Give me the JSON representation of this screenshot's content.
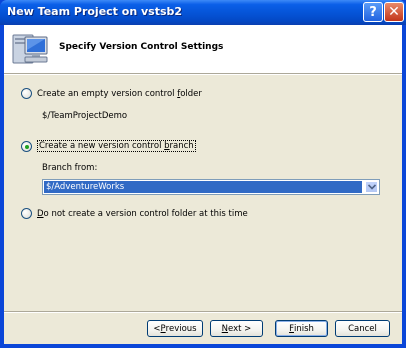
{
  "window": {
    "title": "New Team Project on vstsb2",
    "help_glyph": "?",
    "close_glyph": "✕"
  },
  "header": {
    "title": "Specify Version Control Settings",
    "icon": "computer-icon"
  },
  "options": {
    "empty_folder": {
      "label_pre": "Create an empty version control ",
      "label_accel": "f",
      "label_post": "older",
      "checked": false
    },
    "path_text": "$/TeamProjectDemo",
    "new_branch": {
      "label_pre": "Create a new version control ",
      "label_accel": "b",
      "label_post": "ranch",
      "checked": true
    },
    "branch_from_label": "Branch from:",
    "branch_from_value": "$/AdventureWorks",
    "no_folder": {
      "label_accel": "D",
      "label_post": "o not create a version control folder at this time",
      "checked": false
    }
  },
  "buttons": {
    "previous_pre": "< ",
    "previous_accel": "P",
    "previous_post": "revious",
    "next_accel": "N",
    "next_post": "ext >",
    "finish_accel": "F",
    "finish_post": "inish",
    "cancel": "Cancel"
  },
  "colors": {
    "title_bar": "#0553d6",
    "selection": "#316ac5",
    "radio_dot": "#21a121"
  }
}
